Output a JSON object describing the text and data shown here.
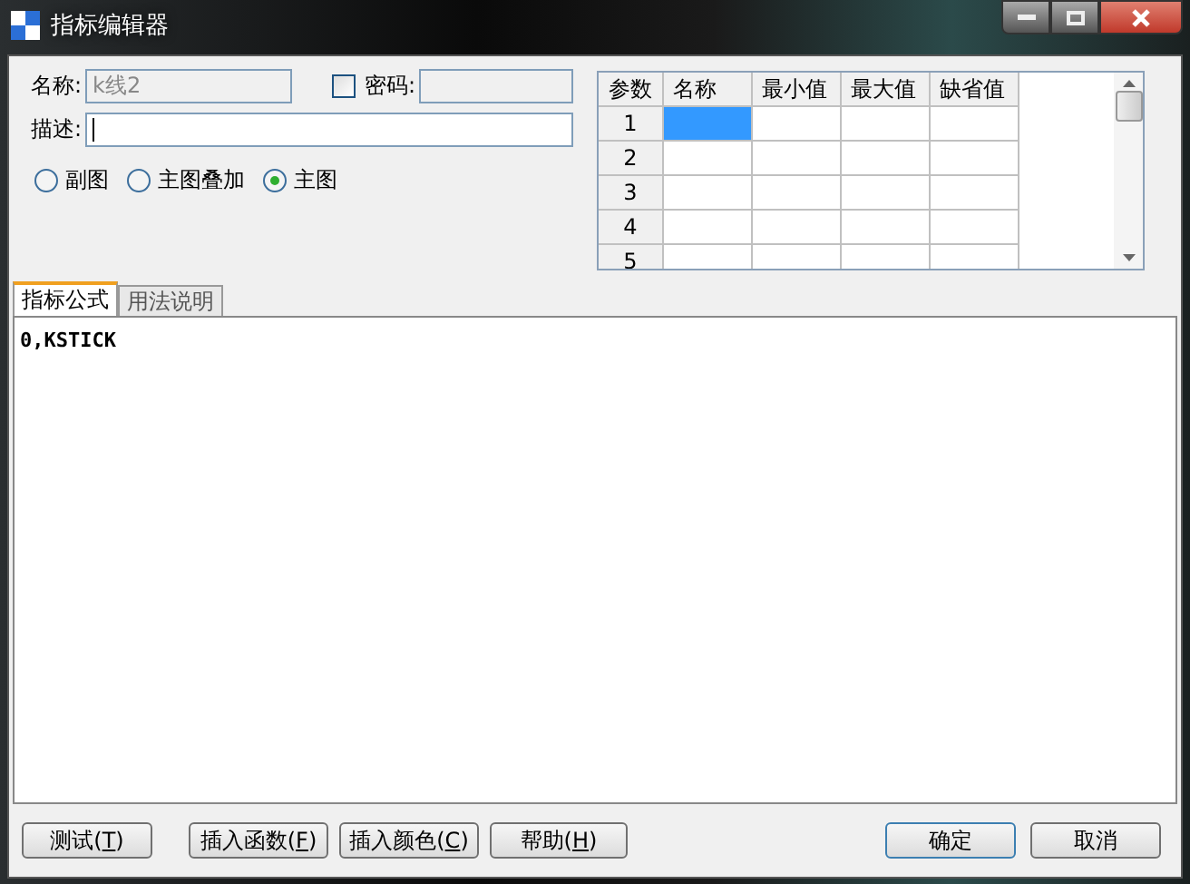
{
  "window": {
    "title": "指标编辑器"
  },
  "form": {
    "name": {
      "label": "名称:",
      "value": "k线2",
      "disabled": true
    },
    "password": {
      "label": "密码:",
      "checked": false,
      "disabled": true
    },
    "description": {
      "label": "描述:",
      "focused": true
    },
    "chart_modes": [
      {
        "label": "副图",
        "selected": false
      },
      {
        "label": "主图叠加",
        "selected": false
      },
      {
        "label": "主图",
        "selected": true
      }
    ]
  },
  "params_table": {
    "columns": [
      "参数",
      "名称",
      "最小值",
      "最大值",
      "缺省值"
    ],
    "rows": [
      {
        "number": "1",
        "cells": [
          {
            "selected": true
          },
          {
            "selected": false
          },
          {
            "selected": false
          },
          {
            "selected": false
          }
        ]
      },
      {
        "number": "2",
        "cells": [
          {
            "selected": false
          },
          {
            "selected": false
          },
          {
            "selected": false
          },
          {
            "selected": false
          }
        ]
      },
      {
        "number": "3",
        "cells": [
          {
            "selected": false
          },
          {
            "selected": false
          },
          {
            "selected": false
          },
          {
            "selected": false
          }
        ]
      },
      {
        "number": "4",
        "cells": [
          {
            "selected": false
          },
          {
            "selected": false
          },
          {
            "selected": false
          },
          {
            "selected": false
          }
        ]
      },
      {
        "number": "5",
        "cells": [
          {
            "selected": false
          },
          {
            "selected": false
          },
          {
            "selected": false
          },
          {
            "selected": false
          }
        ]
      }
    ]
  },
  "tabs": [
    {
      "label": "指标公式",
      "selected": true
    },
    {
      "label": "用法说明",
      "selected": false
    }
  ],
  "editor": {
    "value": "0,KSTICK"
  },
  "buttons_left": [
    {
      "before": "测试(",
      "key": "T",
      "after": ")"
    },
    {
      "before": "插入函数(",
      "key": "F",
      "after": ")"
    },
    {
      "before": "插入颜色(",
      "key": "C",
      "after": ")"
    },
    {
      "before": "帮助(",
      "key": "H",
      "after": ")"
    }
  ],
  "buttons_right": [
    {
      "label": "确定",
      "default": true
    },
    {
      "label": "取消",
      "default": false
    }
  ]
}
